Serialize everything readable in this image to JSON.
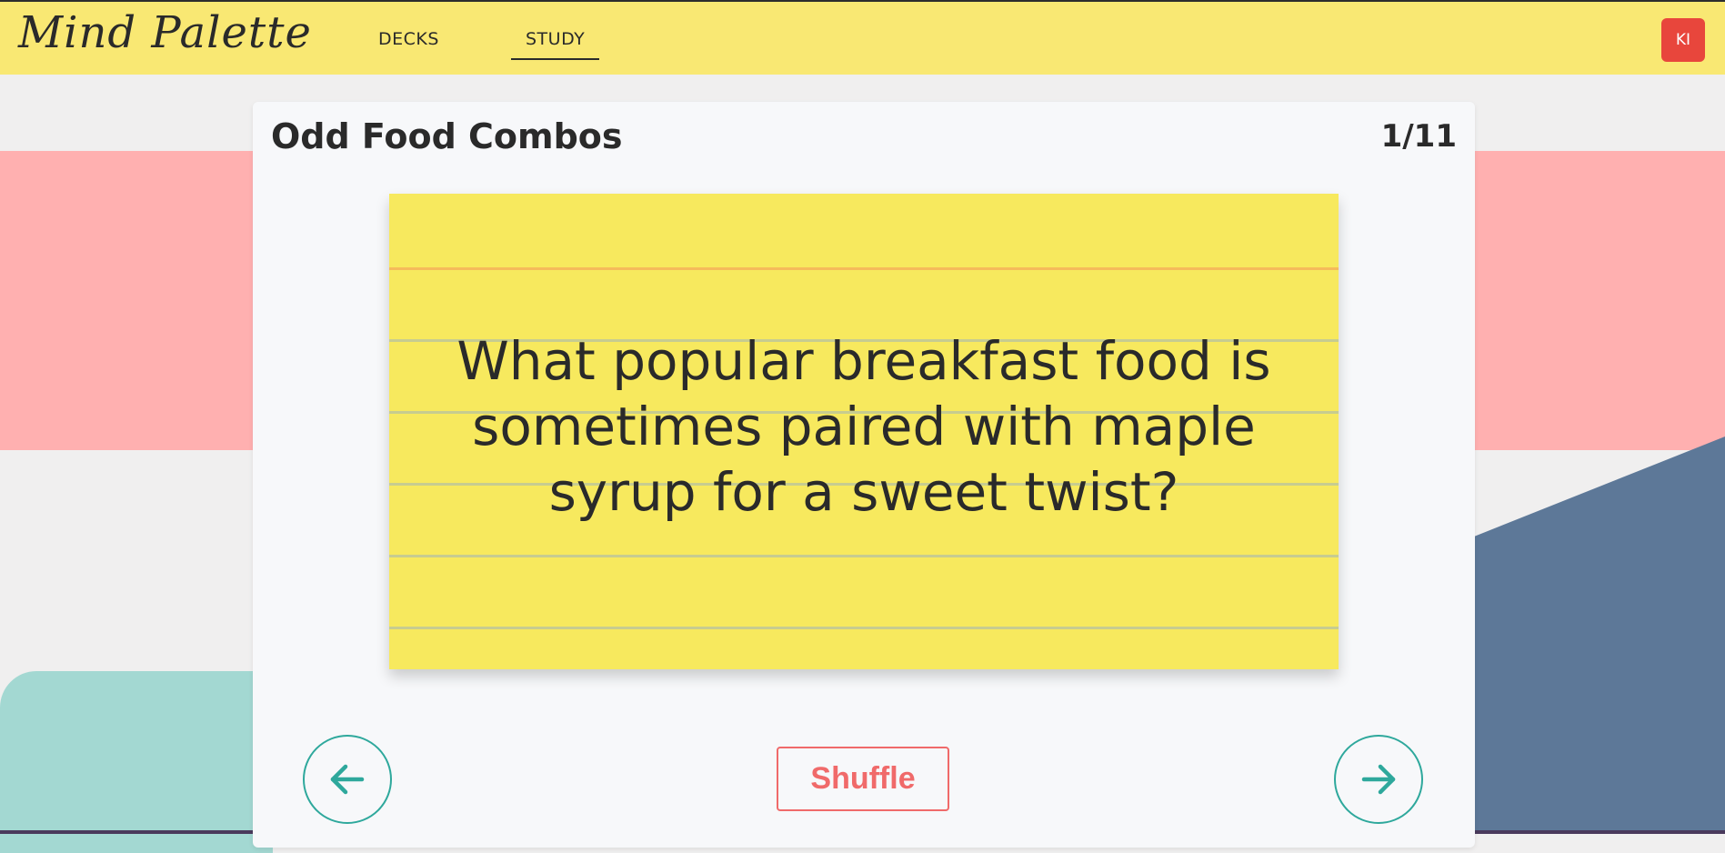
{
  "header": {
    "logo_text": "Mind Palette",
    "nav": [
      {
        "label": "DECKS",
        "active": false
      },
      {
        "label": "STUDY",
        "active": true
      }
    ],
    "avatar_initials": "KI",
    "background_color": "#f9e873",
    "avatar_color": "#e8463c"
  },
  "study": {
    "deck_title": "Odd Food Combos",
    "counter": "1/11",
    "card": {
      "text": "What popular breakfast food is sometimes paired with maple syrup for a sweet twist?",
      "color": "#f7e95e"
    },
    "controls": {
      "prev_icon": "arrow-left-icon",
      "shuffle_label": "Shuffle",
      "next_icon": "arrow-right-icon",
      "accent_color": "#2ea89c",
      "shuffle_color": "#f06a6a"
    }
  }
}
